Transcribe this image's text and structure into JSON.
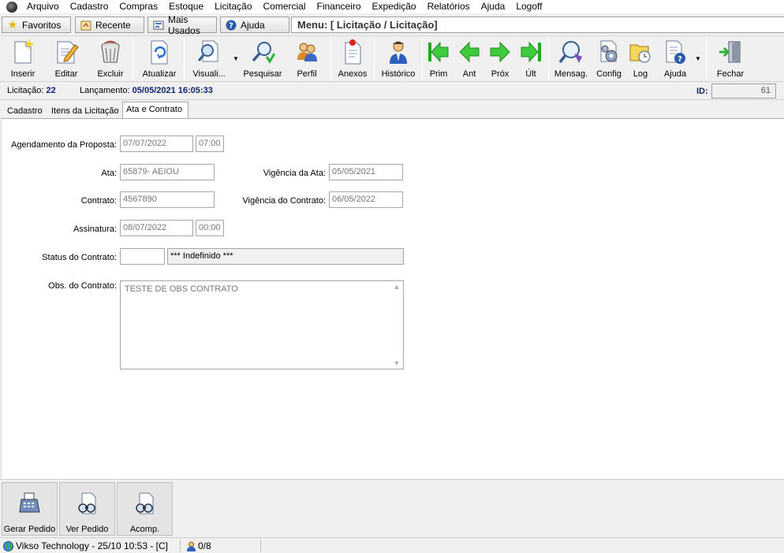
{
  "menubar": {
    "items": [
      "Arquivo",
      "Cadastro",
      "Compras",
      "Estoque",
      "Licitação",
      "Comercial",
      "Financeiro",
      "Expedição",
      "Relatórios",
      "Ajuda",
      "Logoff"
    ]
  },
  "quickbar": {
    "favoritos": "Favoritos",
    "recente": "Recente",
    "mais_usados": "Mais Usados",
    "ajuda": "Ajuda",
    "menu_path": "Menu: [ Licitação / Licitação]"
  },
  "toolbar": {
    "inserir": "Inserir",
    "editar": "Editar",
    "excluir": "Excluir",
    "atualizar": "Atualizar",
    "visualizar": "Visuali...",
    "pesquisar": "Pesquisar",
    "perfil": "Perfil",
    "anexos": "Anexos",
    "historico": "Histórico",
    "prim": "Prim",
    "ant": "Ant",
    "prox": "Próx",
    "ult": "Últ",
    "mensag": "Mensag.",
    "config": "Config",
    "log": "Log",
    "ajuda": "Ajuda",
    "fechar": "Fechar"
  },
  "info": {
    "licitacao_label": "Licitação:",
    "licitacao_value": "22",
    "lancamento_label": "Lançamento:",
    "lancamento_value": "05/05/2021 16:05:33",
    "id_label": "ID:",
    "id_value": "61"
  },
  "tabs": [
    "Cadastro",
    "Itens da Licitação",
    "Ata e Contrato"
  ],
  "form": {
    "agendamento_label": "Agendamento da Proposta:",
    "agendamento_date": "07/07/2022",
    "agendamento_time": "07:00",
    "ata_label": "Ata:",
    "ata_value": "65879- AEIOU",
    "vigencia_ata_label": "Vigência da Ata:",
    "vigencia_ata_value": "05/05/2021",
    "contrato_label": "Contrato:",
    "contrato_value": "4567890",
    "vigencia_contrato_label": "Vigência do Contrato:",
    "vigencia_contrato_value": "06/05/2022",
    "assinatura_label": "Assinatura:",
    "assinatura_date": "08/07/2022",
    "assinatura_time": "00:00",
    "status_label": "Status do Contrato:",
    "status_code": "",
    "status_desc": "*** Indefinido ***",
    "obs_label": "Obs. do Contrato:",
    "obs_value": "TESTE DE OBS CONTRATO"
  },
  "bottom_buttons": {
    "gerar_pedido": "Gerar Pedido",
    "ver_pedido": "Ver Pedido",
    "acomp": "Acomp."
  },
  "statusbar": {
    "company": "Vikso Technology - 25/10 10:53 - [C]",
    "users": "0/8"
  },
  "colors": {
    "accent_text": "#13236e",
    "nav_green": "#2fbf2f",
    "panel_bg": "#ffffff",
    "window_bg": "#f0f0f0"
  }
}
